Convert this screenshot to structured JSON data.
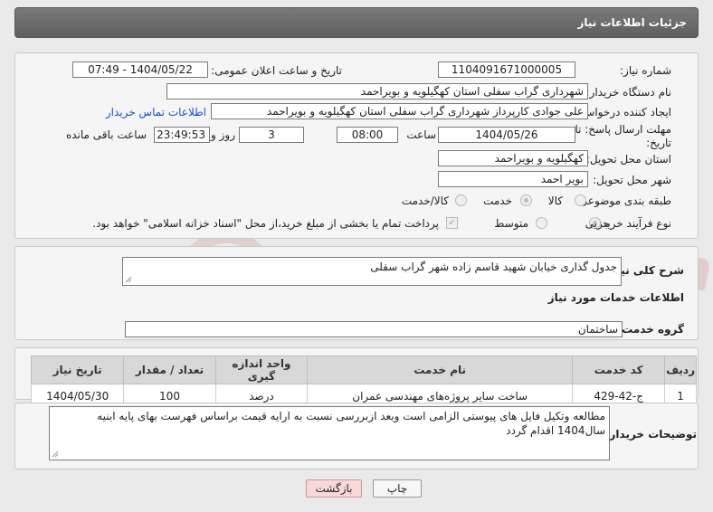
{
  "header": {
    "title": "جزئیات اطلاعات نیاز"
  },
  "details": {
    "need_number_label": "شماره نیاز:",
    "need_number": "1104091671000005",
    "announce_label": "تاریخ و ساعت اعلان عمومی:",
    "announce_value": "1404/05/22 - 07:49",
    "buyer_org_label": "نام دستگاه خریدار:",
    "buyer_org": "شهرداری گراب سفلی استان کهگیلویه و بویراحمد",
    "requester_label": "ایجاد کننده درخواست:",
    "requester": "علی جوادی کارپرداز شهرداری گراب سفلی استان کهگیلویه و بویراحمد",
    "contact_link": "اطلاعات تماس خریدار",
    "deadline_label_1": "مهلت ارسال پاسخ: تا",
    "deadline_label_2": "تاریخ:",
    "deadline_date": "1404/05/26",
    "time_label": "ساعت",
    "deadline_time": "08:00",
    "days_value": "3",
    "days_label": "روز و",
    "remaining_time": "23:49:53",
    "remaining_label": "ساعت باقی مانده",
    "province_label": "استان محل تحویل:",
    "province": "کهگیلویه و بویراحمد",
    "city_label": "شهر محل تحویل:",
    "city": "بویر احمد",
    "category_label": "طبقه بندی موضوعی:",
    "category_options": [
      "کالا",
      "خدمت",
      "کالا/خدمت"
    ],
    "category_selected": "خدمت",
    "process_label": "نوع فرآیند خرید :",
    "process_options": [
      "جزیی",
      "متوسط"
    ],
    "process_selected": "جزیی",
    "payment_note": "پرداخت تمام یا بخشی از مبلغ خرید،از محل \"اسناد خزانه اسلامی\" خواهد بود."
  },
  "summary": {
    "label": "شرح کلی نیاز:",
    "text": "جدول گذاری خیابان شهید قاسم زاده شهر گراب سفلی"
  },
  "services": {
    "heading": "اطلاعات خدمات مورد نیاز",
    "group_label": "گروه خدمت:",
    "group_value": "ساختمان",
    "columns": [
      "ردیف",
      "کد خدمت",
      "نام خدمت",
      "واحد اندازه گیری",
      "تعداد / مقدار",
      "تاریخ نیاز"
    ],
    "rows": [
      {
        "row": "1",
        "code": "ج-42-429",
        "name": "ساخت سایر پروژه‌های مهندسی عمران",
        "unit": "درصد",
        "qty": "100",
        "date": "1404/05/30"
      }
    ]
  },
  "buyer_notes": {
    "label": "توضیحات خریدار:",
    "text": "مطالعه وتکیل فایل های پیوستی الزامی است وبعد ازبررسی نسبت به ارایه قیمت براساس فهرست بهای پایه ابنیه سال1404 اقدام گردد"
  },
  "buttons": {
    "print": "چاپ",
    "back": "بازگشت"
  },
  "watermark": {
    "text": "AriaTender.neT"
  }
}
